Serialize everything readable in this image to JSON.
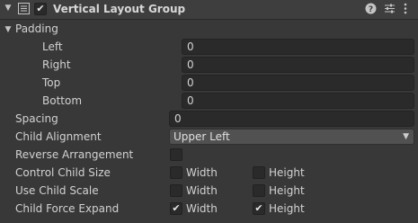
{
  "component": {
    "title": "Vertical Layout Group",
    "enabled": true,
    "icons": {
      "component": "list-layout-icon",
      "help": "help-icon",
      "presets": "sliders-icon",
      "menu": "kebab-menu-icon"
    }
  },
  "padding": {
    "label": "Padding",
    "fields": [
      {
        "label": "Left",
        "value": "0"
      },
      {
        "label": "Right",
        "value": "0"
      },
      {
        "label": "Top",
        "value": "0"
      },
      {
        "label": "Bottom",
        "value": "0"
      }
    ]
  },
  "spacing": {
    "label": "Spacing",
    "value": "0"
  },
  "child_alignment": {
    "label": "Child Alignment",
    "value": "Upper Left"
  },
  "reverse_arrangement": {
    "label": "Reverse Arrangement",
    "checked": false
  },
  "control_child_size": {
    "label": "Control Child Size",
    "width_label": "Width",
    "width_checked": false,
    "height_label": "Height",
    "height_checked": false
  },
  "use_child_scale": {
    "label": "Use Child Scale",
    "width_label": "Width",
    "width_checked": false,
    "height_label": "Height",
    "height_checked": false
  },
  "child_force_expand": {
    "label": "Child Force Expand",
    "width_label": "Width",
    "width_checked": true,
    "height_label": "Height",
    "height_checked": true
  }
}
